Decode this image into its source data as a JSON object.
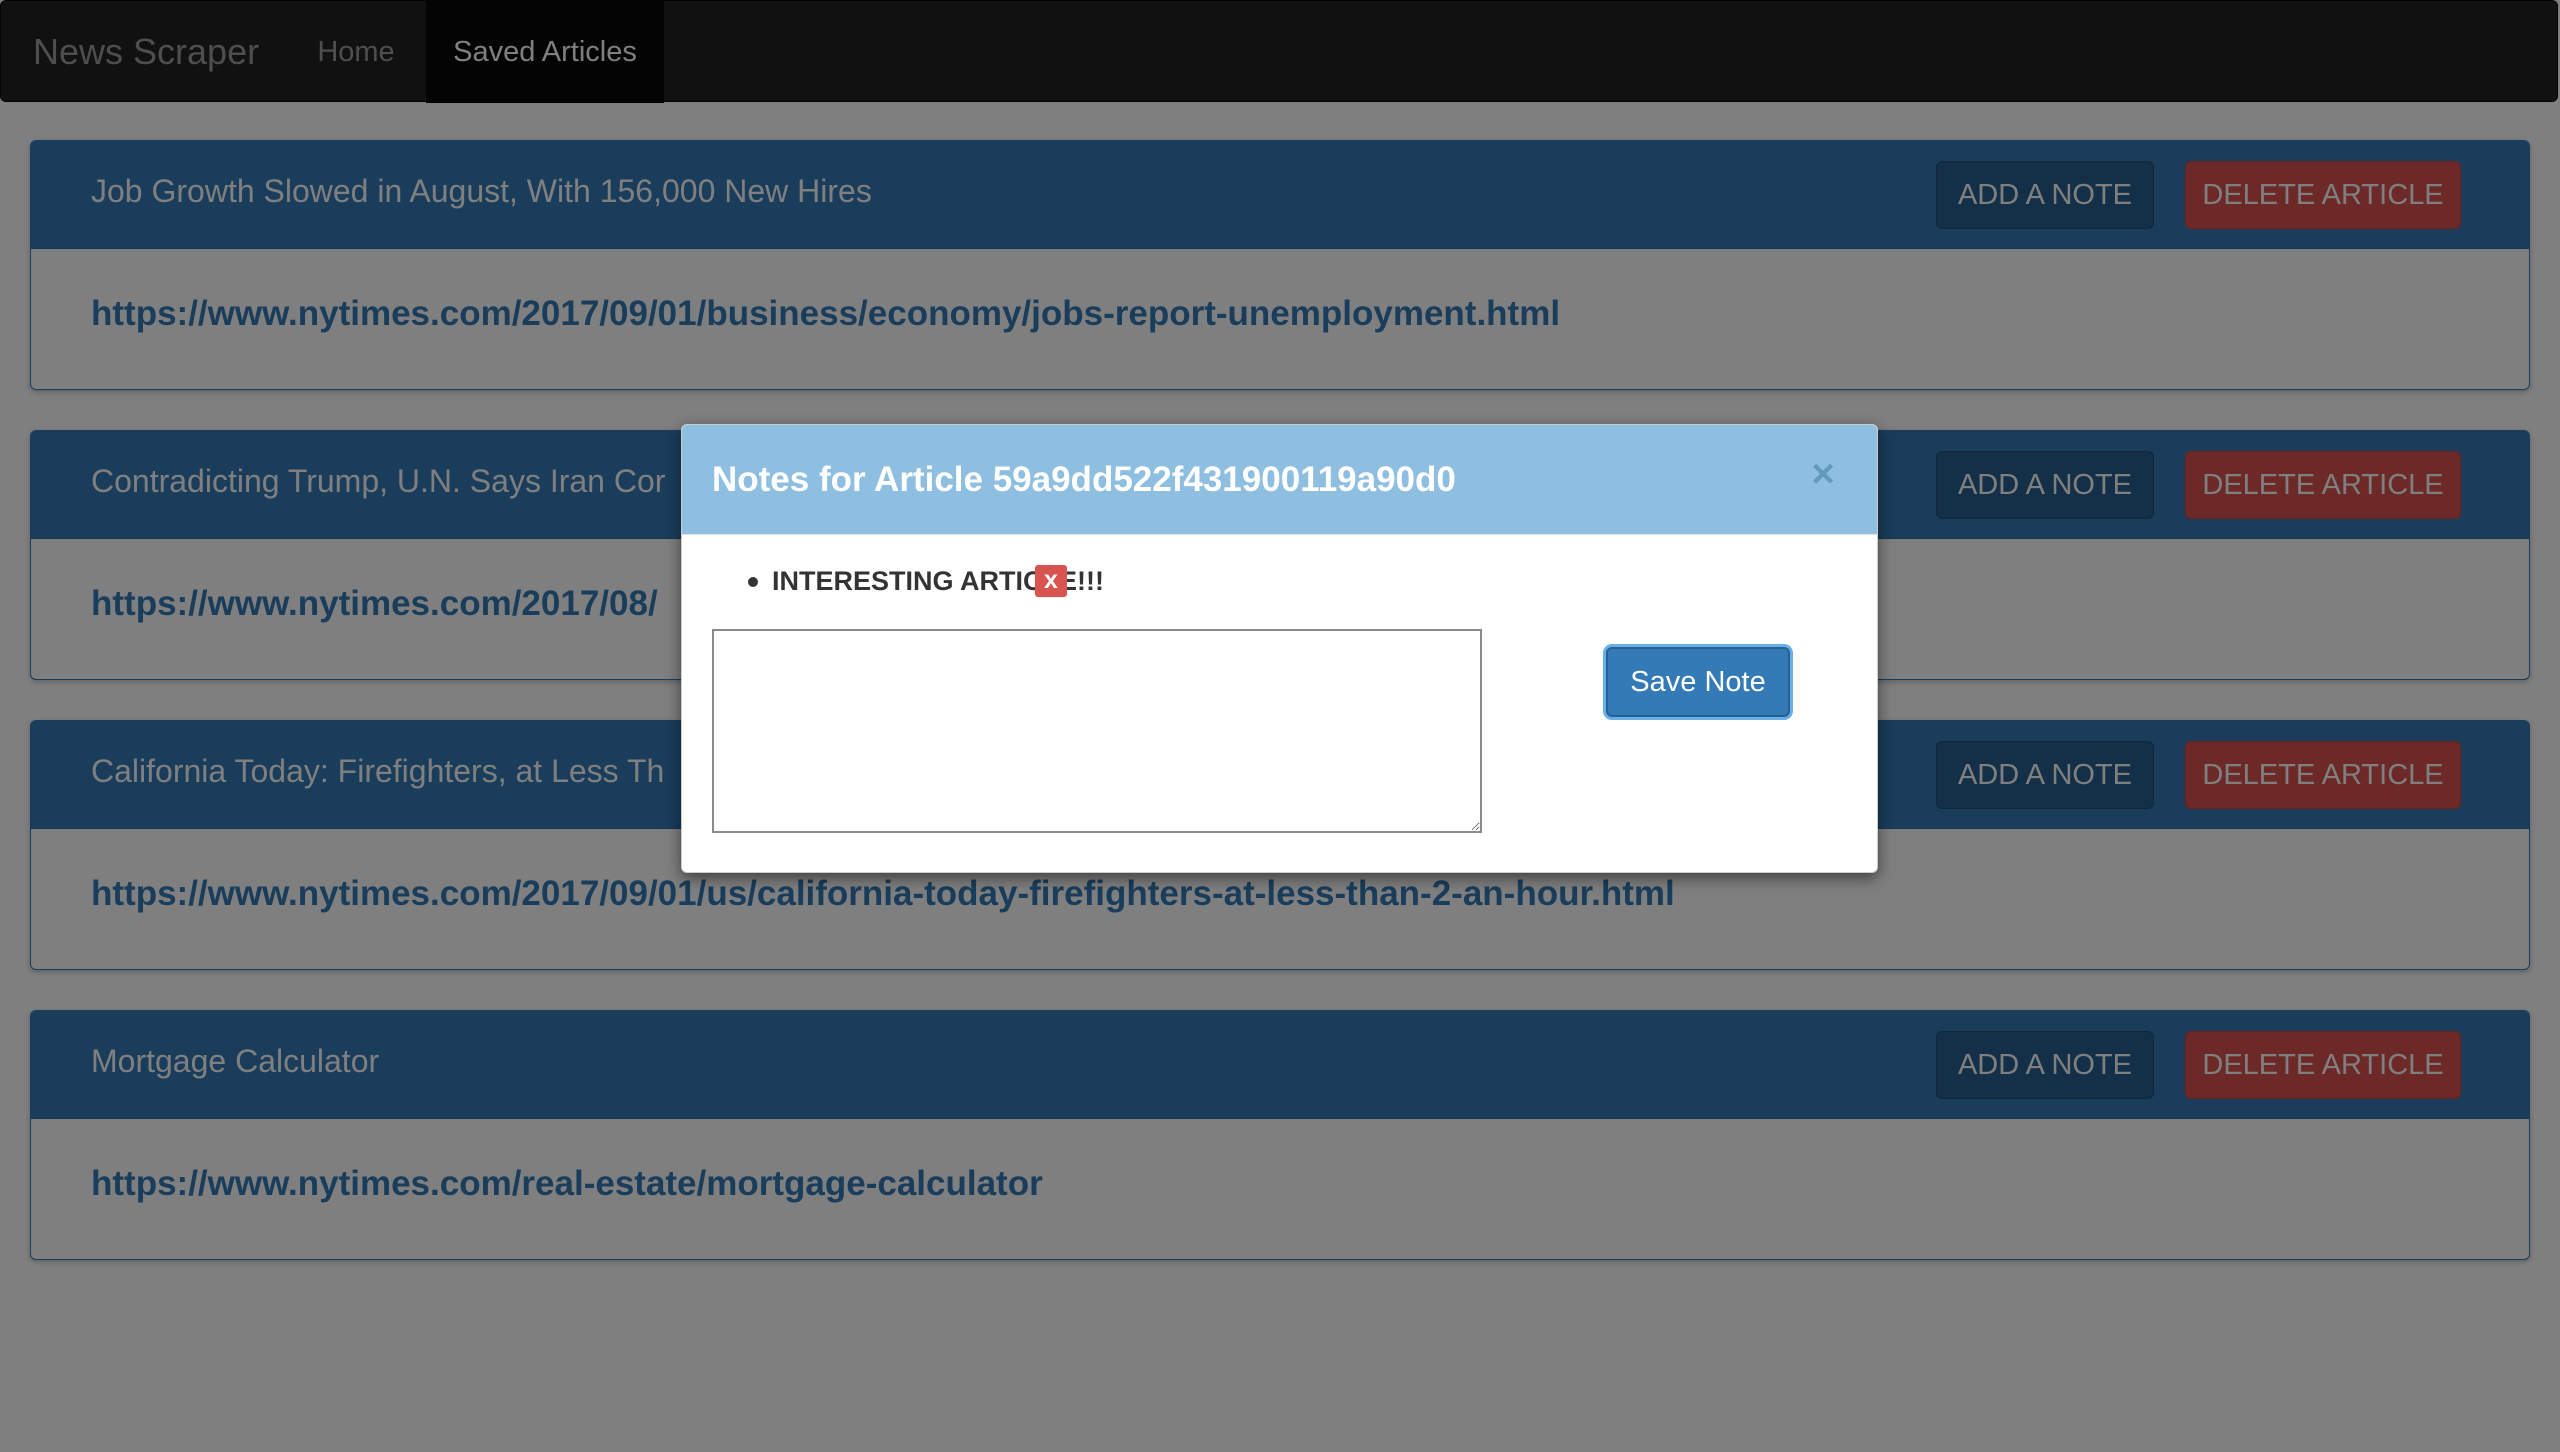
{
  "navbar": {
    "brand": "News Scraper",
    "items": [
      {
        "label": "Home",
        "active": false
      },
      {
        "label": "Saved Articles",
        "active": true
      }
    ]
  },
  "articles": [
    {
      "title": "Job Growth Slowed in August, With 156,000 New Hires",
      "url": "https://www.nytimes.com/2017/09/01/business/economy/jobs-report-unemployment.html",
      "add_note_label": "ADD A NOTE",
      "delete_label": "DELETE ARTICLE"
    },
    {
      "title": "Contradicting Trump, U.N. Says Iran Cor",
      "url": "https://www.nytimes.com/2017/08/",
      "add_note_label": "ADD A NOTE",
      "delete_label": "DELETE ARTICLE"
    },
    {
      "title": "California Today: Firefighters, at Less Th",
      "url": "https://www.nytimes.com/2017/09/01/us/california-today-firefighters-at-less-than-2-an-hour.html",
      "add_note_label": "ADD A NOTE",
      "delete_label": "DELETE ARTICLE"
    },
    {
      "title": "Mortgage Calculator",
      "url": "https://www.nytimes.com/real-estate/mortgage-calculator",
      "add_note_label": "ADD A NOTE",
      "delete_label": "DELETE ARTICLE"
    }
  ],
  "modal": {
    "title": "Notes for Article 59a9dd522f431900119a90d0",
    "close_glyph": "×",
    "notes": [
      {
        "text": "INTERESTING ARTICLE!!!",
        "delete_glyph": "x"
      }
    ],
    "textarea_value": "",
    "save_label": "Save Note"
  },
  "colors": {
    "navbar_bg": "#222222",
    "panel_primary": "#337ab7",
    "danger": "#d9534f",
    "modal_header": "#8fbfe0"
  }
}
